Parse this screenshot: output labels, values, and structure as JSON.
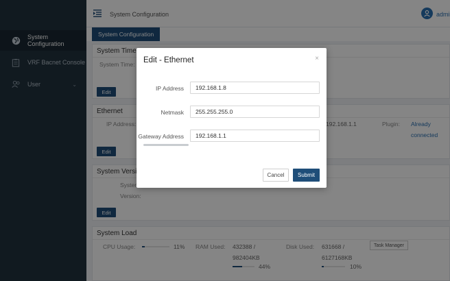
{
  "sidebar": {
    "items": [
      {
        "label": "System Configuration",
        "icon": "globe-icon"
      },
      {
        "label": "VRF Bacnet Console",
        "icon": "clipboard-icon"
      },
      {
        "label": "User",
        "icon": "users-icon"
      }
    ]
  },
  "header": {
    "title": "System Configuration",
    "user": "admi"
  },
  "tabs": [
    {
      "label": "System Configuration"
    }
  ],
  "panels": {
    "system_time": {
      "title": "System Time",
      "label": "System Time:",
      "edit": "Edit"
    },
    "ethernet": {
      "title": "Ethernet",
      "ip_label": "IP Address:",
      "gateway_value": "192.168.1.1",
      "plugin_label": "Plugin:",
      "plugin_value_line1": "Already",
      "plugin_value_line2": "connected",
      "edit": "Edit"
    },
    "system_version": {
      "title": "System Versio",
      "system_label": "Systen",
      "version_label": "Version:",
      "edit": "Edit"
    },
    "system_load": {
      "title": "System Load",
      "cpu_label": "CPU Usage:",
      "cpu_pct": "11%",
      "cpu_fraction": 0.11,
      "ram_label": "RAM Used:",
      "ram_used": "432388 /",
      "ram_total": "982404KB",
      "ram_pct": "44%",
      "ram_fraction": 0.44,
      "disk_label": "Disk Used:",
      "disk_used": "631668 /",
      "disk_total": "6127168KB",
      "disk_pct": "10%",
      "disk_fraction": 0.1,
      "task_manager": "Task Manager"
    }
  },
  "modal": {
    "title": "Edit - Ethernet",
    "close": "×",
    "fields": {
      "ip": {
        "label": "IP Address",
        "value": "192.168.1.8"
      },
      "netmask": {
        "label": "Netmask",
        "value": "255.255.255.0"
      },
      "gateway": {
        "label": "Gateway Address",
        "value": "192.168.1.1"
      }
    },
    "cancel": "Cancel",
    "submit": "Submit"
  },
  "colors": {
    "sidebar_bg": "#22323f",
    "primary": "#1f4e79",
    "accent": "#2a6fb0"
  }
}
